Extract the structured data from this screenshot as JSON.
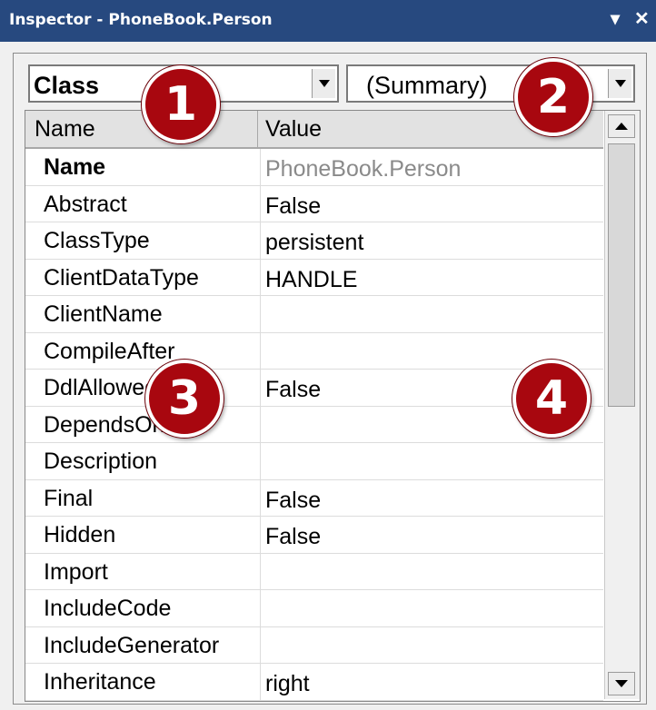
{
  "window": {
    "title": "Inspector - PhoneBook.Person",
    "controls": {
      "dropdown_icon": "triangle-down-icon",
      "close_icon": "close-icon"
    }
  },
  "combos": {
    "left_value": "Class",
    "right_value": "(Summary)"
  },
  "grid": {
    "columns": [
      "Name",
      "Value"
    ],
    "rows": [
      {
        "name": "Name",
        "value": "PhoneBook.Person"
      },
      {
        "name": "Abstract",
        "value": "False"
      },
      {
        "name": "ClassType",
        "value": "persistent"
      },
      {
        "name": "ClientDataType",
        "value": "HANDLE"
      },
      {
        "name": "ClientName",
        "value": ""
      },
      {
        "name": "CompileAfter",
        "value": ""
      },
      {
        "name": "DdlAllowed",
        "value": "False"
      },
      {
        "name": "DependsOn",
        "value": ""
      },
      {
        "name": "Description",
        "value": ""
      },
      {
        "name": "Final",
        "value": "False"
      },
      {
        "name": "Hidden",
        "value": "False"
      },
      {
        "name": "Import",
        "value": ""
      },
      {
        "name": "IncludeCode",
        "value": ""
      },
      {
        "name": "IncludeGenerator",
        "value": ""
      },
      {
        "name": "Inheritance",
        "value": "right"
      }
    ]
  },
  "callouts": [
    "1",
    "2",
    "3",
    "4"
  ],
  "colors": {
    "titlebar": "#27497f",
    "callout": "#a8070f"
  }
}
